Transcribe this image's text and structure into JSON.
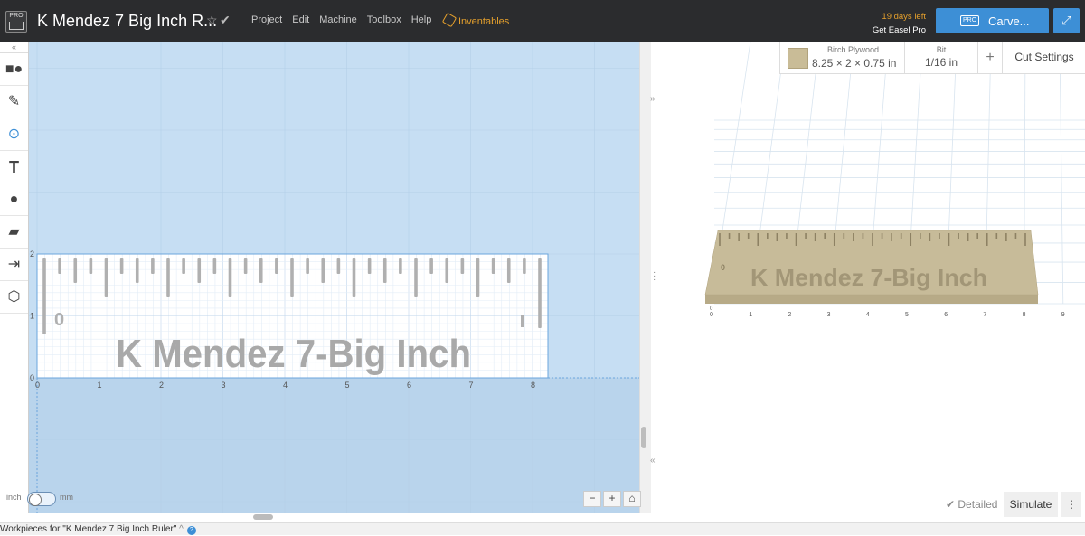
{
  "app": {
    "logo_label": "PRO",
    "project_title": "K Mendez 7 Big Inch R...",
    "menu": [
      "Project",
      "Edit",
      "Machine",
      "Toolbox",
      "Help"
    ],
    "inventables_label": "Inventables",
    "trial_days": "19 days left",
    "get_pro": "Get Easel Pro",
    "carve_badge": "PRO",
    "carve_label": "Carve..."
  },
  "material": {
    "name": "Birch Plywood",
    "dimensions": "8.25 × 2 × 0.75 in",
    "swatch_color": "#c9bc97"
  },
  "bit": {
    "label": "Bit",
    "value": "1/16 in"
  },
  "cut_settings": "Cut Settings",
  "units": {
    "left": "inch",
    "right": "mm",
    "selected": "inch"
  },
  "design": {
    "text": "K Mendez 7-Big Inch",
    "zero_mark": "0",
    "x_ticks": [
      "0",
      "1",
      "2",
      "3",
      "4",
      "5",
      "6",
      "7",
      "8"
    ],
    "y_ticks": [
      "0",
      "1",
      "2"
    ]
  },
  "preview": {
    "text": "K Mendez 7-Big Inch",
    "x_ticks": [
      "0",
      "1",
      "2",
      "3",
      "4",
      "5",
      "6",
      "7",
      "8",
      "9"
    ]
  },
  "bottom": {
    "detailed": "Detailed",
    "simulate": "Simulate",
    "workpieces": "Workpieces for \"K Mendez 7 Big Inch Ruler\""
  },
  "colors": {
    "accent": "#3d8fd6",
    "inventables": "#e5a02c",
    "canvas": "#c6def3"
  }
}
